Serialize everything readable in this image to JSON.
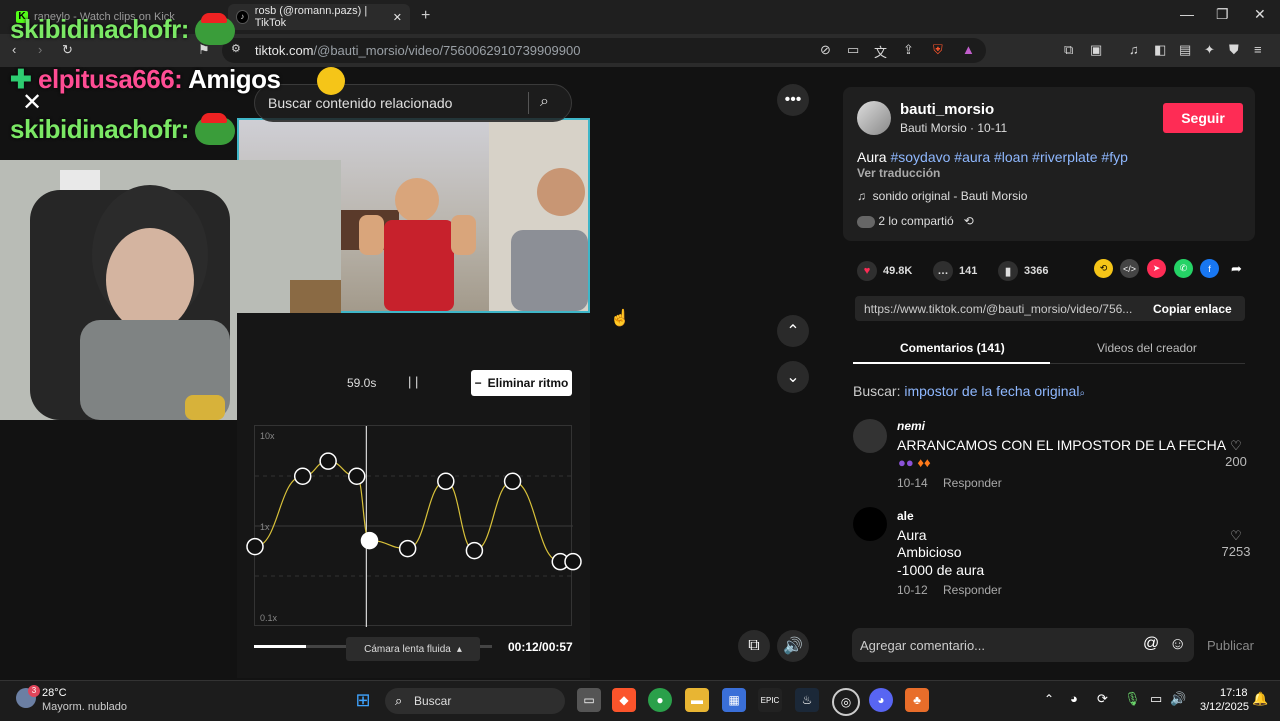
{
  "browser": {
    "tabs": [
      {
        "title": "raneylo - Watch clips on Kick"
      },
      {
        "title": "rosb (@romann.pazs) | TikTok"
      }
    ],
    "url": {
      "host": "tiktok.com",
      "path": "/@bauti_morsio/video/7560062910739909900"
    }
  },
  "overlay": {
    "chat": [
      {
        "name": "skibidinachofr:",
        "message": ""
      },
      {
        "name": "elpitusa666:",
        "message": "Amigos"
      },
      {
        "name": "skibidinachofr:",
        "message": ""
      }
    ]
  },
  "player": {
    "search_placeholder": "Buscar contenido relacionado",
    "timecode": "59.0s",
    "remove_beat_label": "Eliminar ritmo",
    "graph_labels": {
      "top": "10x",
      "mid": "1x",
      "bottom": "0.1x"
    },
    "camera_mode": "Cámara lenta fluida",
    "time": "00:12/00:57",
    "progress_fraction": 0.22
  },
  "speed_curve": {
    "points": [
      {
        "x": 0,
        "y": 0.8
      },
      {
        "x": 0.15,
        "y": 1.5
      },
      {
        "x": 0.23,
        "y": 1.65
      },
      {
        "x": 0.32,
        "y": 1.5
      },
      {
        "x": 0.36,
        "y": 0.86,
        "active": true
      },
      {
        "x": 0.48,
        "y": 0.78
      },
      {
        "x": 0.6,
        "y": 1.45
      },
      {
        "x": 0.69,
        "y": 0.76
      },
      {
        "x": 0.81,
        "y": 1.45
      },
      {
        "x": 0.96,
        "y": 0.65
      },
      {
        "x": 1.0,
        "y": 0.65
      }
    ],
    "playhead_x": 0.35
  },
  "post": {
    "username": "bauti_morsio",
    "display_line": "Bauti Morsio · 10-11",
    "follow_label": "Seguir",
    "caption_word": "Aura",
    "hashtags": [
      "#soydavo",
      "#aura",
      "#loan",
      "#riverplate",
      "#fyp"
    ],
    "translate_label": "Ver traducción",
    "sound": "sonido original - Bauti Morsio",
    "shared": "2 lo compartió",
    "likes": "49.8K",
    "comments": "141",
    "saves": "3366",
    "link": "https://www.tiktok.com/@bauti_morsio/video/756...",
    "copy_label": "Copiar enlace",
    "tab_comments": "Comentarios (141)",
    "tab_creator": "Videos del creador",
    "search_label": "Buscar:",
    "search_query": "impostor de la fecha original"
  },
  "comments": [
    {
      "name": "nemi",
      "text": [
        "ARRANCAMOS CON EL IMPOSTOR DE LA FECHA"
      ],
      "date": "10-14",
      "reply": "Responder",
      "likes": "200"
    },
    {
      "name": "ale",
      "text": [
        "Aura",
        "Ambicioso",
        "-1000 de aura"
      ],
      "date": "10-12",
      "reply": "Responder",
      "likes": "7253"
    }
  ],
  "composer": {
    "placeholder": "Agregar comentario...",
    "publish": "Publicar"
  },
  "taskbar": {
    "weather_temp": "28°C",
    "weather_desc": "Mayorm. nublado",
    "weather_badge": "3",
    "search_label": "Buscar",
    "time": "17:18",
    "date": "3/12/2025"
  },
  "colors": {
    "accent": "#fe2c55",
    "hashtag": "#8fb8ff",
    "chat_name": "#7be865",
    "frame": "#3fb6c8"
  }
}
